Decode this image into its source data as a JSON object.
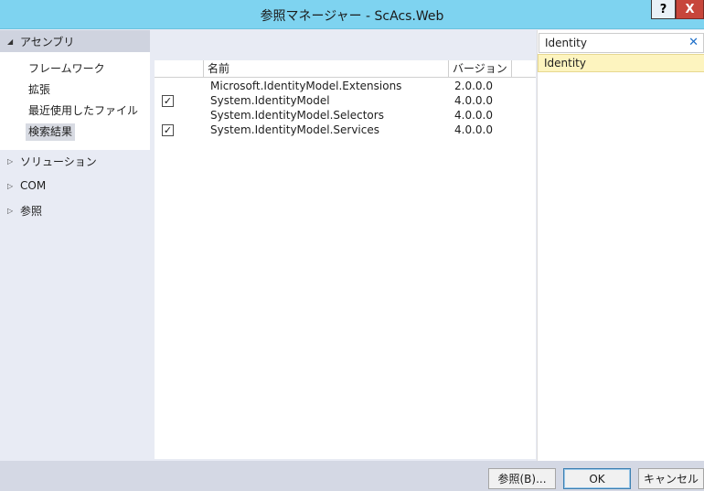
{
  "window": {
    "title": "参照マネージャー - ScAcs.Web",
    "help_label": "?",
    "close_label": "X"
  },
  "sidebar": {
    "assemblies": {
      "label": "アセンブリ",
      "items": [
        {
          "label": "フレームワーク"
        },
        {
          "label": "拡張"
        },
        {
          "label": "最近使用したファイル"
        },
        {
          "label": "検索結果",
          "selected": true
        }
      ]
    },
    "groups": [
      {
        "label": "ソリューション"
      },
      {
        "label": "COM"
      },
      {
        "label": "参照"
      }
    ]
  },
  "list": {
    "columns": {
      "name": "名前",
      "version": "バージョン"
    },
    "rows": [
      {
        "name": "Microsoft.IdentityModel.Extensions",
        "version": "2.0.0.0",
        "checked": false
      },
      {
        "name": "System.IdentityModel",
        "version": "4.0.0.0",
        "checked": true
      },
      {
        "name": "System.IdentityModel.Selectors",
        "version": "4.0.0.0",
        "checked": false
      },
      {
        "name": "System.IdentityModel.Services",
        "version": "4.0.0.0",
        "checked": true
      }
    ]
  },
  "search": {
    "value": "Identity",
    "suggestion": "Identity"
  },
  "buttons": {
    "browse": "参照(B)...",
    "ok": "OK",
    "cancel": "キャンセル"
  },
  "colors": {
    "titlebar": "#7ed3f0",
    "close": "#c7463b",
    "suggest": "#fdf4bf"
  }
}
